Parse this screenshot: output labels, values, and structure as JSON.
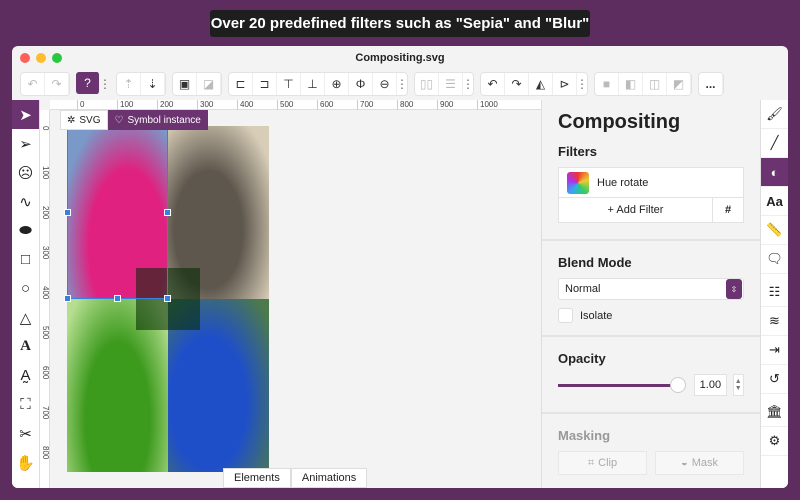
{
  "banner": "Over 20 predefined filters such as \"Sepia\" and \"Blur\"",
  "window": {
    "title": "Compositing.svg"
  },
  "ruler": {
    "h": [
      "0",
      "100",
      "200",
      "300",
      "400",
      "500",
      "600",
      "700",
      "800",
      "900",
      "1000"
    ],
    "v": [
      "0",
      "100",
      "200",
      "300",
      "400",
      "500",
      "600",
      "700",
      "800"
    ]
  },
  "chips": {
    "svg": "SVG",
    "symbol": "Symbol instance"
  },
  "bottom_tabs": [
    "Elements",
    "Animations"
  ],
  "panel": {
    "title": "Compositing",
    "filters_heading": "Filters",
    "filter_item": "Hue rotate",
    "add_filter": "+ Add Filter",
    "hash": "#",
    "blend_heading": "Blend Mode",
    "blend_value": "Normal",
    "isolate": "Isolate",
    "opacity_heading": "Opacity",
    "opacity_value": "1.00",
    "opacity_fraction": 1.0,
    "masking_heading": "Masking",
    "clip": "Clip",
    "mask": "Mask"
  },
  "toolbar": {
    "more": "..."
  },
  "colors": {
    "accent": "#6b3370",
    "background": "#5e2d5f"
  }
}
